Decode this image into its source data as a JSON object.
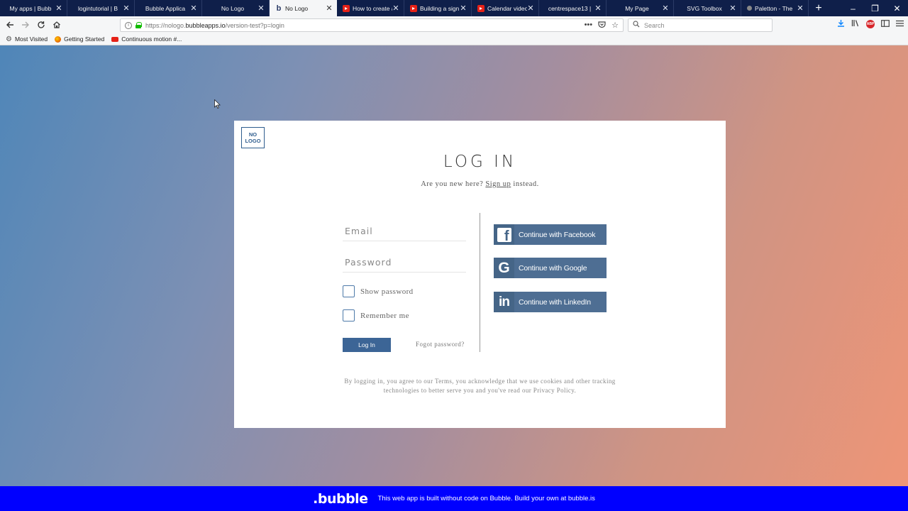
{
  "browser": {
    "tabs": [
      {
        "title": "My apps | Bubb",
        "icon": "none"
      },
      {
        "title": "logintutorial | B",
        "icon": "none"
      },
      {
        "title": "Bubble Applica",
        "icon": "none"
      },
      {
        "title": "No Logo",
        "icon": "none"
      },
      {
        "title": "No Logo",
        "icon": "bubble-icon",
        "active": true
      },
      {
        "title": "How to create a",
        "icon": "youtube-icon"
      },
      {
        "title": "Building a sign",
        "icon": "youtube-icon"
      },
      {
        "title": "Calendar video",
        "icon": "youtube-icon"
      },
      {
        "title": "centrespace13 |",
        "icon": "none"
      },
      {
        "title": "My Page",
        "icon": "none"
      },
      {
        "title": "SVG Toolbox",
        "icon": "none"
      },
      {
        "title": "Paletton - The",
        "icon": "paletton-icon"
      }
    ],
    "new_tab_symbol": "+",
    "window_controls": {
      "minimize": "–",
      "restore": "❐",
      "close": "✕"
    },
    "url_prefix": "https://nologo.",
    "url_domain": "bubbleapps.io",
    "url_path": "/version-test?p=login",
    "search_placeholder": "Search",
    "bookmarks": [
      {
        "label": "Most Visited",
        "icon": "gear-icon"
      },
      {
        "label": "Getting Started",
        "icon": "firefox-icon"
      },
      {
        "label": "Continuous motion #...",
        "icon": "youtube-icon"
      }
    ]
  },
  "login": {
    "logo_line1": "NO",
    "logo_line2": "LOGO",
    "title": "LOG IN",
    "subtitle_prefix": "Are you new here?",
    "signup_link": "Sign up",
    "subtitle_suffix": "instead.",
    "email_placeholder": "Email",
    "password_placeholder": "Password",
    "show_password_label": "Show password",
    "remember_me_label": "Remember me",
    "login_button": "Log In",
    "forgot_password": "Fogot password?",
    "social": {
      "facebook": "Continue with Facebook",
      "google": "Continue with Google",
      "linkedin": "Continue with LinkedIn"
    },
    "terms_line1": "By logging in, you agree to our Terms, you acknowledge that we use cookies and other tracking",
    "terms_line2": "technologies to better serve you and you've read our Privacy Policy."
  },
  "banner": {
    "logo": ".bubble",
    "text": "This web app is built without code on Bubble. Build your own at bubble.is"
  },
  "colors": {
    "tabbar": "#0f1f4a",
    "primary_button": "#3c6596",
    "social_button": "#4e6e93",
    "banner": "#0000ff"
  }
}
